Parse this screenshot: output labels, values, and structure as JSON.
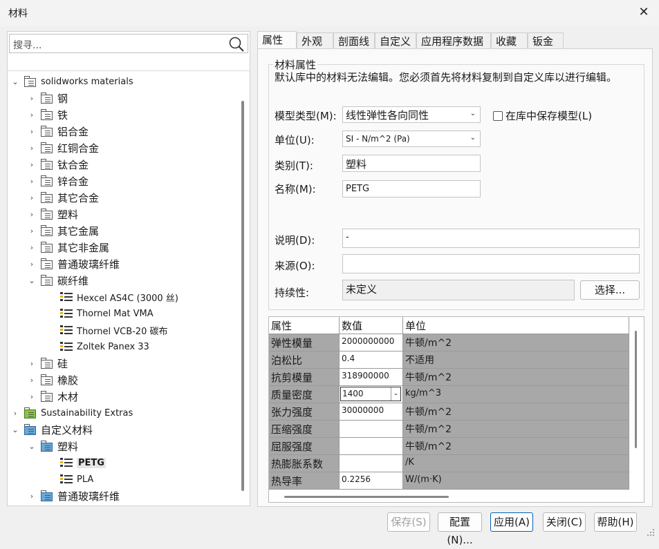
{
  "window": {
    "title": "材料",
    "close": "✕"
  },
  "search": {
    "placeholder": "搜寻..."
  },
  "tree": [
    {
      "label": "solidworks materials",
      "level": 0,
      "toggle": "⌄",
      "icon": "library-icon",
      "en": true
    },
    {
      "label": "钢",
      "level": 1,
      "toggle": "›",
      "icon": "folder-icon"
    },
    {
      "label": "铁",
      "level": 1,
      "toggle": "›",
      "icon": "folder-icon"
    },
    {
      "label": "铝合金",
      "level": 1,
      "toggle": "›",
      "icon": "folder-icon"
    },
    {
      "label": "红铜合金",
      "level": 1,
      "toggle": "›",
      "icon": "folder-icon"
    },
    {
      "label": "钛合金",
      "level": 1,
      "toggle": "›",
      "icon": "folder-icon"
    },
    {
      "label": "锌合金",
      "level": 1,
      "toggle": "›",
      "icon": "folder-icon"
    },
    {
      "label": "其它合金",
      "level": 1,
      "toggle": "›",
      "icon": "folder-icon"
    },
    {
      "label": "塑料",
      "level": 1,
      "toggle": "›",
      "icon": "folder-icon"
    },
    {
      "label": "其它金属",
      "level": 1,
      "toggle": "›",
      "icon": "folder-icon"
    },
    {
      "label": "其它非金属",
      "level": 1,
      "toggle": "›",
      "icon": "folder-icon"
    },
    {
      "label": "普通玻璃纤维",
      "level": 1,
      "toggle": "›",
      "icon": "folder-icon"
    },
    {
      "label": "碳纤维",
      "level": 1,
      "toggle": "⌄",
      "icon": "folder-icon"
    },
    {
      "label": "Hexcel AS4C (3000 丝)",
      "level": 2,
      "toggle": "",
      "icon": "material-icon",
      "en": true
    },
    {
      "label": "Thornel Mat VMA",
      "level": 2,
      "toggle": "",
      "icon": "material-icon",
      "en": true
    },
    {
      "label": "Thornel VCB-20 碳布",
      "level": 2,
      "toggle": "",
      "icon": "material-icon",
      "en": true
    },
    {
      "label": "Zoltek Panex 33",
      "level": 2,
      "toggle": "",
      "icon": "material-icon",
      "en": true
    },
    {
      "label": "硅",
      "level": 1,
      "toggle": "›",
      "icon": "folder-icon"
    },
    {
      "label": "橡胶",
      "level": 1,
      "toggle": "›",
      "icon": "folder-icon"
    },
    {
      "label": "木材",
      "level": 1,
      "toggle": "›",
      "icon": "folder-icon"
    },
    {
      "label": "Sustainability Extras",
      "level": 0,
      "toggle": "›",
      "icon": "library-green-icon",
      "en": true
    },
    {
      "label": "自定义材料",
      "level": 0,
      "toggle": "⌄",
      "icon": "library-blue-icon"
    },
    {
      "label": "塑料",
      "level": 1,
      "toggle": "⌄",
      "icon": "folder-blue-icon"
    },
    {
      "label": "PETG",
      "level": 2,
      "toggle": "",
      "icon": "material-icon",
      "en": true,
      "selected": true
    },
    {
      "label": "PLA",
      "level": 2,
      "toggle": "",
      "icon": "material-icon",
      "en": true
    },
    {
      "label": "普通玻璃纤维",
      "level": 1,
      "toggle": "›",
      "icon": "folder-blue-icon"
    }
  ],
  "tabs": [
    "属性",
    "外观",
    "剖面线",
    "自定义",
    "应用程序数据",
    "收藏",
    "钣金"
  ],
  "props": {
    "group_title": "材料属性",
    "note": "默认库中的材料无法编辑。您必须首先将材料复制到自定义库以进行编辑。",
    "model_type_label": "模型类型(M):",
    "model_type_value": "线性弹性各向同性",
    "save_model_label": "在库中保存模型(L)",
    "units_label": "单位(U):",
    "units_value": "SI - N/m^2 (Pa)",
    "category_label": "类别(T):",
    "category_value": "塑料",
    "name_label": "名称(M):",
    "name_value": "PETG",
    "desc_label": "说明(D):",
    "desc_value": "-",
    "source_label": "来源(O):",
    "source_value": "",
    "sustain_label": "持续性:",
    "sustain_value": "未定义",
    "select_btn": "选择..."
  },
  "table": {
    "headers": [
      "属性",
      "数值",
      "单位"
    ],
    "rows": [
      {
        "name": "弹性模量",
        "value": "2000000000",
        "unit": "牛顿/m^2"
      },
      {
        "name": "泊松比",
        "value": "0.4",
        "unit": "不适用"
      },
      {
        "name": "抗剪模量",
        "value": "318900000",
        "unit": "牛顿/m^2"
      },
      {
        "name": "质量密度",
        "value": "1400",
        "unit": "kg/m^3",
        "editing": true
      },
      {
        "name": "张力强度",
        "value": "30000000",
        "unit": "牛顿/m^2"
      },
      {
        "name": "压缩强度",
        "value": "",
        "unit": "牛顿/m^2"
      },
      {
        "name": "屈服强度",
        "value": "",
        "unit": "牛顿/m^2"
      },
      {
        "name": "热膨胀系数",
        "value": "",
        "unit": "/K"
      },
      {
        "name": "热导率",
        "value": "0.2256",
        "unit": "W/(m·K)"
      }
    ]
  },
  "buttons": {
    "save": "保存(S)",
    "config": "配置(N)...",
    "apply": "应用(A)",
    "close": "关闭(C)",
    "help": "帮助(H)"
  }
}
